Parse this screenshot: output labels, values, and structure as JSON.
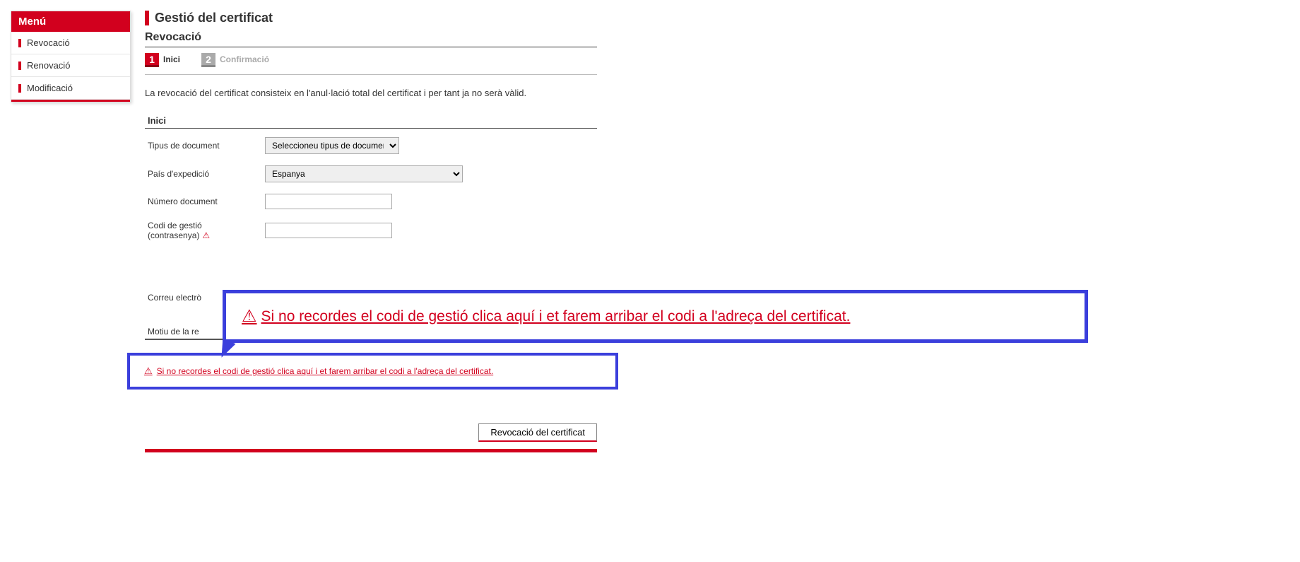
{
  "sidebar": {
    "title": "Menú",
    "items": [
      {
        "label": "Revocació"
      },
      {
        "label": "Renovació"
      },
      {
        "label": "Modificació"
      }
    ]
  },
  "page": {
    "title": "Gestió del certificat",
    "subtitle": "Revocació",
    "intro": "La revocació del certificat consisteix en l'anul·lació total del certificat i per tant ja no serà vàlid."
  },
  "steps": [
    {
      "num": "1",
      "label": "Inici",
      "active": true
    },
    {
      "num": "2",
      "label": "Confirmació",
      "active": false
    }
  ],
  "form": {
    "section_header": "Inici",
    "doc_type_label": "Tipus de document",
    "doc_type_selected": "Seleccioneu tipus de document",
    "country_label": "País d'expedició",
    "country_selected": "Espanya",
    "doc_number_label": "Número document",
    "doc_number_value": "",
    "code_label_line1": "Codi de gestió",
    "code_label_line2": "(contrasenya)",
    "code_value": "",
    "email_label_partial": "Correu electrò",
    "motiu_label_partial": "Motiu de la re"
  },
  "help_link_text": "Si no recordes el codi de gestió clica aquí i et farem arribar el codi a l'adreça del certificat.",
  "submit_label": "Revocació del certificat"
}
